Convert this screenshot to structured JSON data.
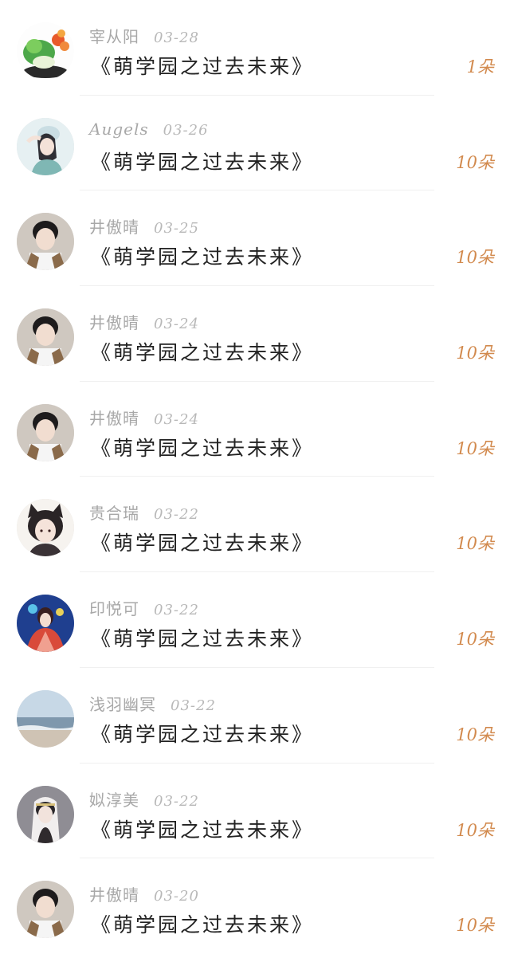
{
  "gift_list": {
    "items": [
      {
        "name": "宰从阳",
        "date": "03-28",
        "title": "《萌学园之过去未来》",
        "flowers": "1朵",
        "avatar": "plant-avatar"
      },
      {
        "name": "Augels",
        "date": "03-26",
        "title": "《萌学园之过去未来》",
        "flowers": "10朵",
        "avatar": "girl-avatar"
      },
      {
        "name": "井傲晴",
        "date": "03-25",
        "title": "《萌学园之过去未来》",
        "flowers": "10朵",
        "avatar": "boy-avatar"
      },
      {
        "name": "井傲晴",
        "date": "03-24",
        "title": "《萌学园之过去未来》",
        "flowers": "10朵",
        "avatar": "boy-avatar"
      },
      {
        "name": "井傲晴",
        "date": "03-24",
        "title": "《萌学园之过去未来》",
        "flowers": "10朵",
        "avatar": "boy-avatar"
      },
      {
        "name": "贵合瑞",
        "date": "03-22",
        "title": "《萌学园之过去未来》",
        "flowers": "10朵",
        "avatar": "cat-girl-avatar"
      },
      {
        "name": "印悦可",
        "date": "03-22",
        "title": "《萌学园之过去未来》",
        "flowers": "10朵",
        "avatar": "hanfu-avatar"
      },
      {
        "name": "浅羽幽冥",
        "date": "03-22",
        "title": "《萌学园之过去未来》",
        "flowers": "10朵",
        "avatar": "sea-avatar"
      },
      {
        "name": "姒淳美",
        "date": "03-22",
        "title": "《萌学园之过去未来》",
        "flowers": "10朵",
        "avatar": "veil-girl-avatar"
      },
      {
        "name": "井傲晴",
        "date": "03-20",
        "title": "《萌学园之过去未来》",
        "flowers": "10朵",
        "avatar": "boy-avatar"
      }
    ]
  },
  "colors": {
    "name": "#a8a8a8",
    "date": "#b8b8b8",
    "title": "#222222",
    "flowers": "#d28a4e"
  }
}
